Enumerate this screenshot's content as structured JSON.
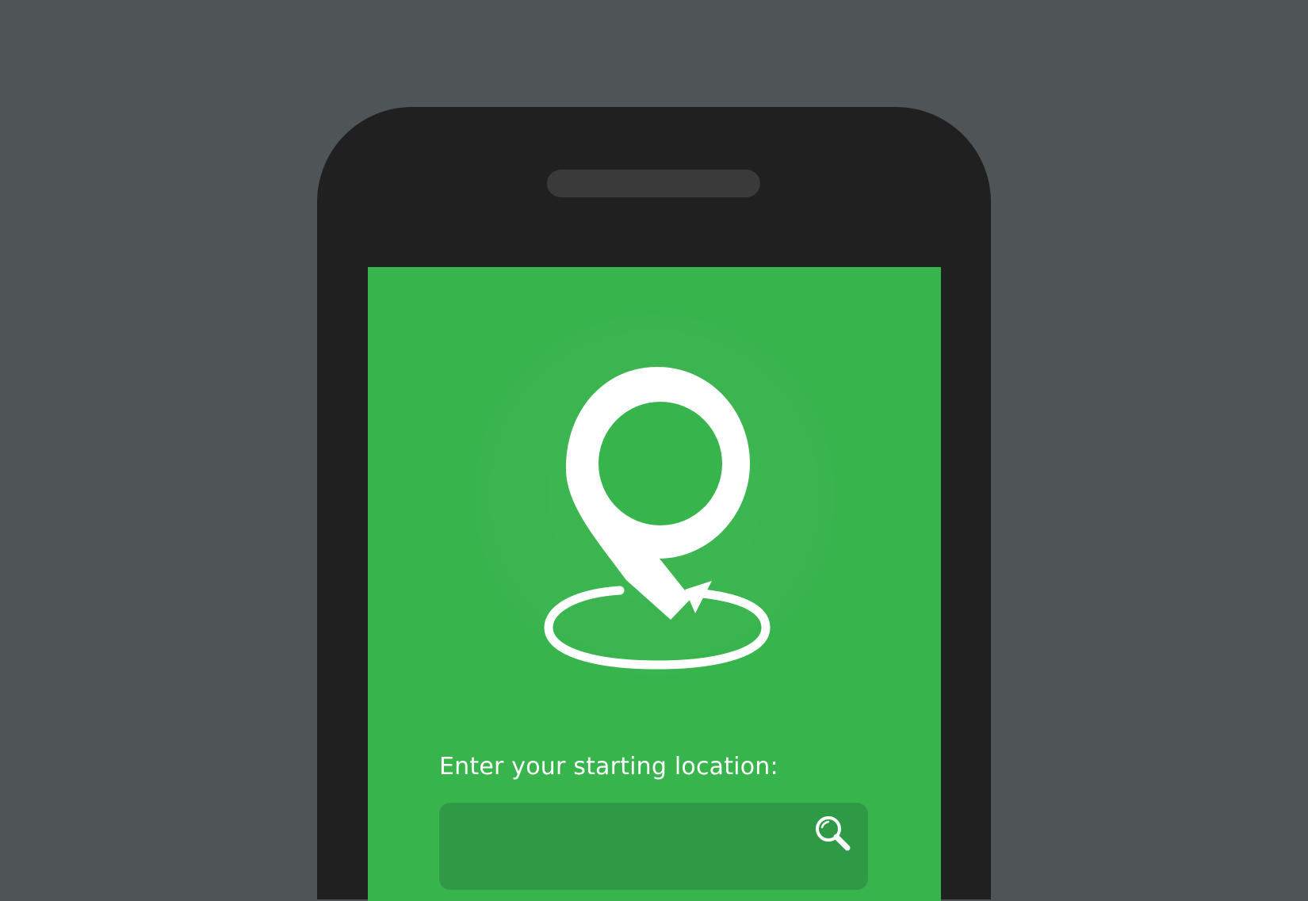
{
  "prompt": {
    "label": "Enter your starting location:"
  },
  "search": {
    "value": "",
    "placeholder": ""
  },
  "icons": {
    "logo": "location-pin-return-icon",
    "search": "search-icon"
  },
  "colors": {
    "background": "#4f5457",
    "phone": "#202020",
    "screen": "#38b44d",
    "input": "#2e9a45",
    "foreground": "#ffffff"
  }
}
